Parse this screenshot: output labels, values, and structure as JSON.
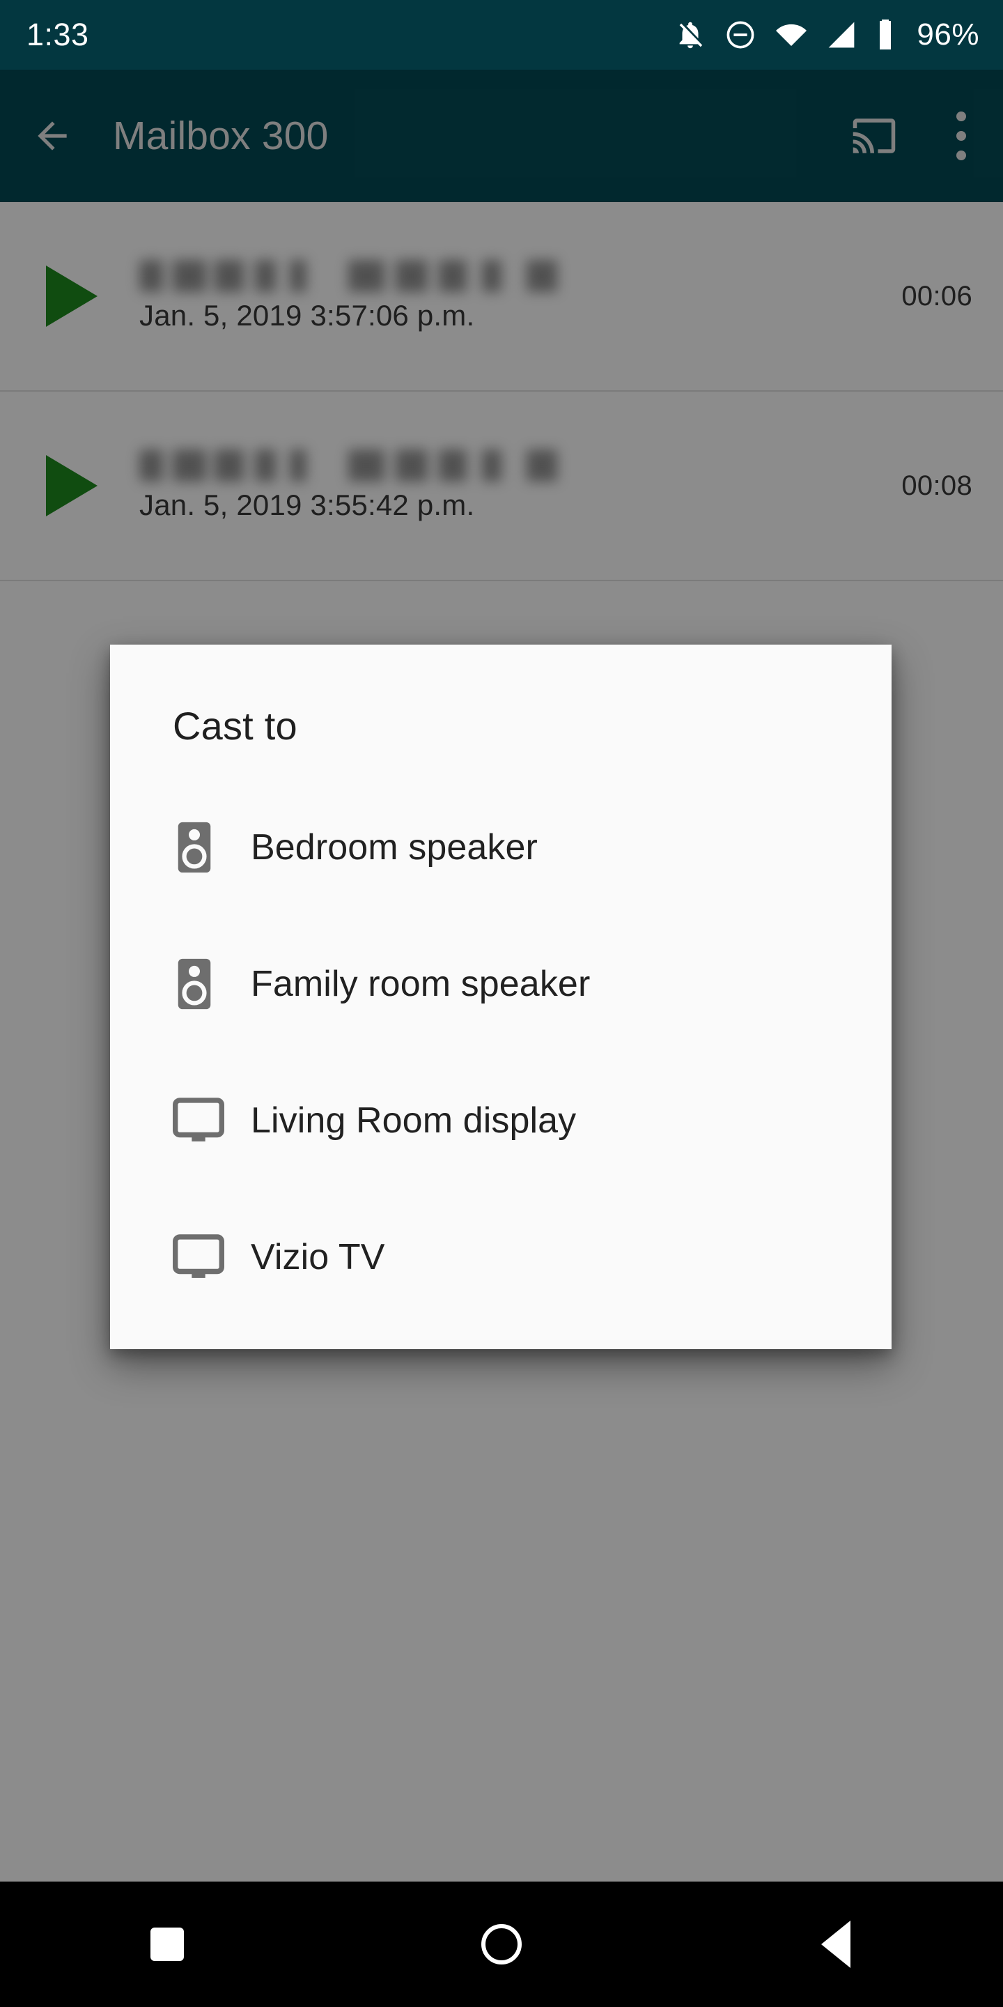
{
  "status_bar": {
    "clock": "1:33",
    "battery_percent": "96%",
    "icons": [
      "notifications-off-icon",
      "do-not-disturb-icon",
      "wifi-icon",
      "cellular-signal-icon",
      "battery-icon"
    ],
    "background_color": "#033740",
    "text_color": "#FFFFFF"
  },
  "app_bar": {
    "title": "Mailbox 300",
    "back_icon": "arrow-back-icon",
    "cast_icon": "cast-icon",
    "overflow_icon": "more-vert-icon",
    "background_color": "#034A55",
    "title_color": "#E8E8E8"
  },
  "voicemail_list": {
    "play_icon": "play-triangle-icon",
    "play_color": "#1E8A1E",
    "rows": [
      {
        "caller": "",
        "caller_redacted": true,
        "date": "Jan. 5, 2019 3:57:06 p.m.",
        "duration": "00:06"
      },
      {
        "caller": "",
        "caller_redacted": true,
        "date": "Jan. 5, 2019 3:55:42 p.m.",
        "duration": "00:08"
      }
    ]
  },
  "cast_dialog": {
    "title": "Cast to",
    "background_color": "#FAFAFA",
    "title_color": "#1F1F1F",
    "icon_color": "#6E6E6E",
    "devices": [
      {
        "label": "Bedroom speaker",
        "icon": "speaker-icon"
      },
      {
        "label": "Family room speaker",
        "icon": "speaker-icon"
      },
      {
        "label": "Living Room display",
        "icon": "display-icon"
      },
      {
        "label": "Vizio TV",
        "icon": "display-icon"
      }
    ]
  },
  "nav_bar": {
    "background_color": "#000000",
    "recents_icon": "square-recents-icon",
    "home_icon": "circle-home-icon",
    "back_icon": "triangle-back-icon"
  }
}
